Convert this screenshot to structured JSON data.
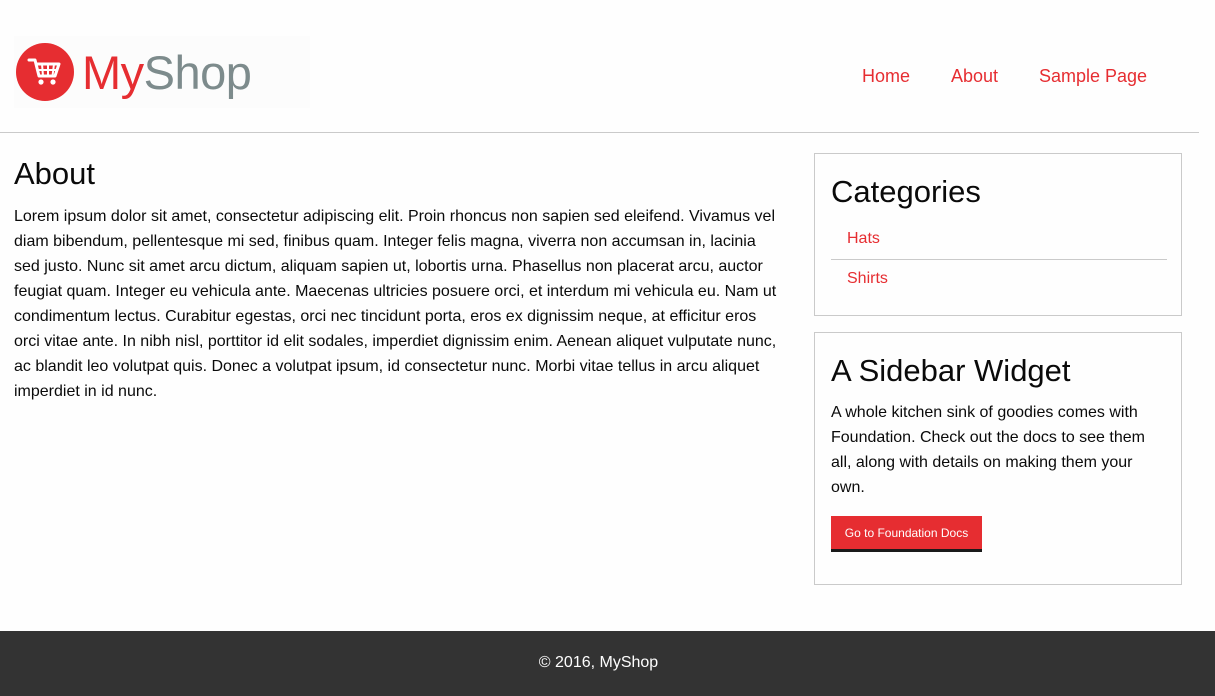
{
  "header": {
    "logo": {
      "text_part1": "My",
      "text_part2": "Shop",
      "icon": "shopping-cart-icon"
    },
    "nav": [
      {
        "label": "Home"
      },
      {
        "label": "About"
      },
      {
        "label": "Sample Page"
      }
    ]
  },
  "main": {
    "title": "About",
    "body": "Lorem ipsum dolor sit amet, consectetur adipiscing elit. Proin rhoncus non sapien sed eleifend. Vivamus vel diam bibendum, pellentesque mi sed, finibus quam. Integer felis magna, viverra non accumsan in, lacinia sed justo. Nunc sit amet arcu dictum, aliquam sapien ut, lobortis urna. Phasellus non placerat arcu, auctor feugiat quam. Integer eu vehicula ante. Maecenas ultricies posuere orci, et interdum mi vehicula eu. Nam ut condimentum lectus. Curabitur egestas, orci nec tincidunt porta, eros ex dignissim neque, at efficitur eros orci vitae ante. In nibh nisl, porttitor id elit sodales, imperdiet dignissim enim. Aenean aliquet vulputate nunc, ac blandit leo volutpat quis. Donec a volutpat ipsum, id consectetur nunc. Morbi vitae tellus in arcu aliquet imperdiet in id nunc."
  },
  "sidebar": {
    "categories": {
      "title": "Categories",
      "items": [
        {
          "label": "Hats"
        },
        {
          "label": "Shirts"
        }
      ]
    },
    "widget": {
      "title": "A Sidebar Widget",
      "text": "A whole kitchen sink of goodies comes with Foundation. Check out the docs to see them all, along with details on making them your own.",
      "button_label": "Go to Foundation Docs"
    }
  },
  "footer": {
    "text": "© 2016, MyShop"
  },
  "colors": {
    "accent": "#e62d31",
    "logo_gray": "#7d8b8c",
    "footer_bg": "#333333",
    "border": "#cacaca"
  }
}
